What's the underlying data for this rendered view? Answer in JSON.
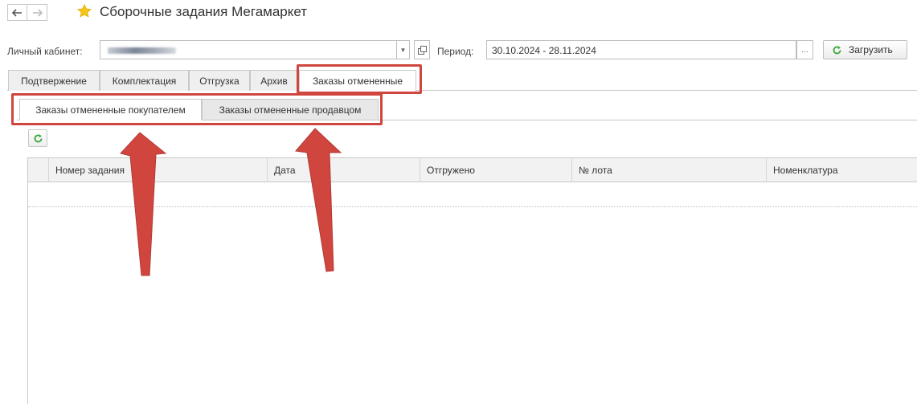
{
  "window": {
    "title": "Сборочные задания Мегамаркет"
  },
  "nav": {
    "back_icon": "arrow-left-icon",
    "forward_icon": "arrow-right-icon",
    "favorite_icon": "star-icon"
  },
  "form": {
    "account_label": "Личный кабинет:",
    "period_label": "Период:",
    "period_value": "30.10.2024 - 28.11.2024",
    "load_button": "Загрузить",
    "dots": "..."
  },
  "tabs": [
    {
      "label": "Подтвержение"
    },
    {
      "label": "Комплектация"
    },
    {
      "label": "Отгрузка"
    },
    {
      "label": "Архив"
    },
    {
      "label": "Заказы отмененные",
      "active": true
    }
  ],
  "subtabs": [
    {
      "label": "Заказы отмененные покупателем",
      "active": true
    },
    {
      "label": "Заказы отмененные продавцом",
      "active": false
    }
  ],
  "table": {
    "columns": [
      "Номер задания",
      "Дата",
      "Отгружено",
      "№ лота",
      "Номенклатура"
    ],
    "rows": []
  },
  "colors": {
    "accent_green": "#3aa63a",
    "annotation_red": "#d0463f",
    "star": "#f5c518"
  }
}
